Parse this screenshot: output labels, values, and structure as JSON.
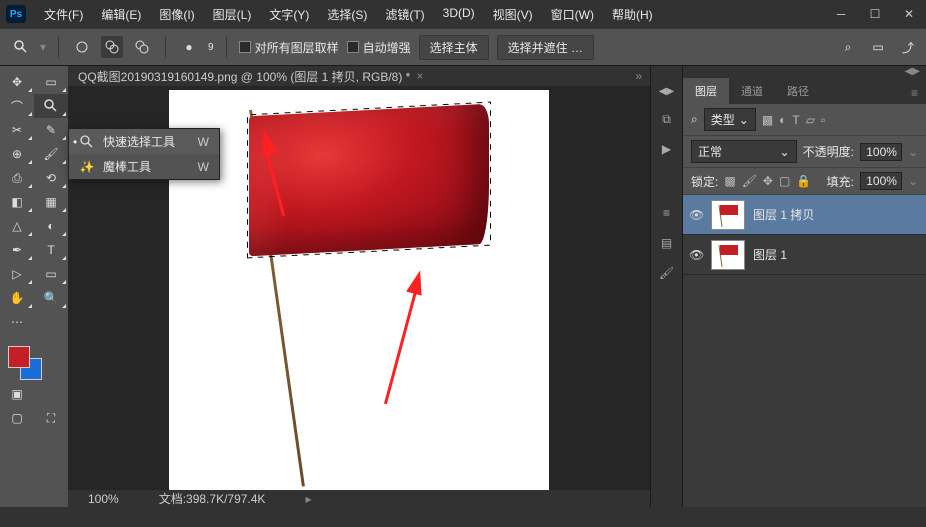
{
  "menu": [
    "文件(F)",
    "编辑(E)",
    "图像(I)",
    "图层(L)",
    "文字(Y)",
    "选择(S)",
    "滤镜(T)",
    "3D(D)",
    "视图(V)",
    "窗口(W)",
    "帮助(H)"
  ],
  "optionbar": {
    "sample_all": "对所有图层取样",
    "auto_enhance": "自动增强",
    "select_subject": "选择主体",
    "select_mask": "选择并遮住 …",
    "brush_size": "9"
  },
  "document_tab": "QQ截图20190319160149.png @ 100% (图层 1 拷贝, RGB/8) *",
  "flyout": {
    "quick_select": "快速选择工具",
    "magic_wand": "魔棒工具",
    "shortcut": "W"
  },
  "status": {
    "zoom": "100%",
    "doc_info": "文档:398.7K/797.4K"
  },
  "panels": {
    "tabs": [
      "图层",
      "通道",
      "路径"
    ],
    "kind_label": "类型",
    "blend_mode": "正常",
    "opacity_label": "不透明度:",
    "opacity_value": "100%",
    "lock_label": "锁定:",
    "fill_label": "填充:",
    "fill_value": "100%",
    "search_icon": "⌕"
  },
  "layers": [
    {
      "name": "图层 1 拷贝",
      "selected": true
    },
    {
      "name": "图层 1",
      "selected": false
    }
  ]
}
